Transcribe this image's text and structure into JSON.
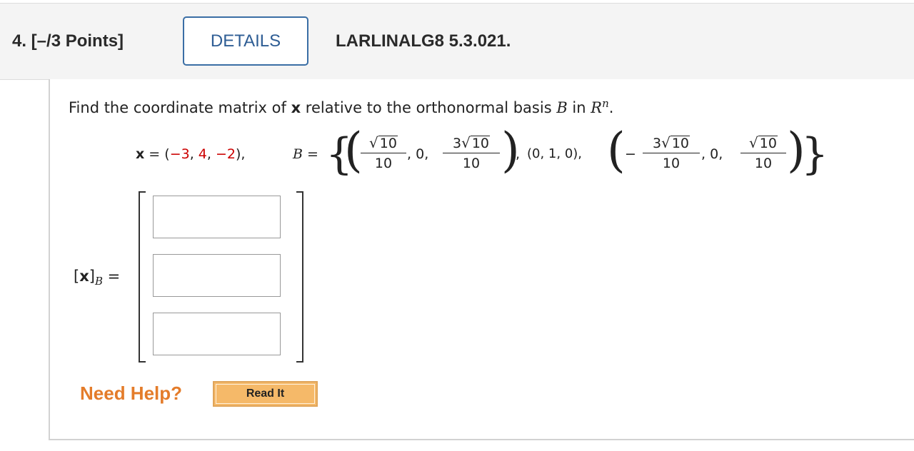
{
  "header": {
    "question_number": "4. [–/3 Points]",
    "details_label": "DETAILS",
    "problem_code": "LARLINALG8 5.3.021."
  },
  "prompt": {
    "part1": "Find the coordinate matrix of ",
    "bold_x": "x",
    "part2": " relative to the orthonormal basis ",
    "basis_var": "B",
    "part3": " in ",
    "space": "R",
    "exponent": "n",
    "period": "."
  },
  "equation": {
    "x_label": "x",
    "eq1": " = ",
    "x_open": "(",
    "x_c1": "−3",
    "x_c2": "4",
    "x_c3": "−2",
    "x_close": "),",
    "sep": ", ",
    "basis_label": "B",
    "eq2": " =",
    "sqrt_sign": "√",
    "radicand": "10",
    "coef": "3",
    "denom": "10",
    "zero": "0",
    "comma": ",",
    "middle_vector": "(0, 1, 0),",
    "minus": "−"
  },
  "answer": {
    "label_open": "[",
    "label_x": "x",
    "label_close": "]",
    "label_sub": "B",
    "label_eq": "=",
    "inputs": [
      "",
      "",
      ""
    ]
  },
  "help": {
    "need_help": "Need Help?",
    "read_it": "Read It"
  },
  "colors": {
    "accent": "#2e5d94",
    "given_values": "#cc0000",
    "need_help": "#e47c2a",
    "read_it_bg": "#f5b969"
  }
}
